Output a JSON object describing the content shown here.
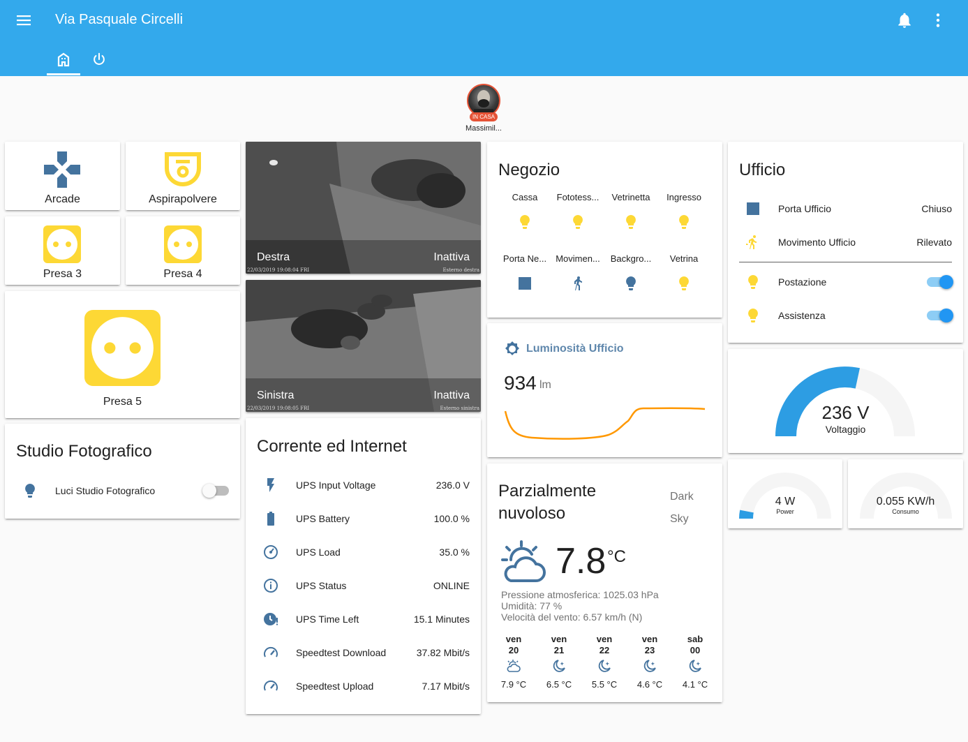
{
  "header": {
    "title": "Via Pasquale Circelli"
  },
  "icons": {
    "menu": "menu-icon",
    "bell": "bell-icon",
    "more": "dots-vertical-icon",
    "tab_home": "home-icon",
    "tab_power": "power-icon"
  },
  "colors": {
    "header": "#33a9ec",
    "on": "#fdd835",
    "off": "#44739e",
    "accent": "#2196f3",
    "graph": "#ff9800"
  },
  "person": {
    "name": "Massimil...",
    "badge": "IN CASA"
  },
  "buttons": {
    "arcade": "Arcade",
    "aspirapolvere": "Aspirapolvere",
    "presa3": "Presa 3",
    "presa4": "Presa 4",
    "presa5": "Presa 5"
  },
  "studio": {
    "title": "Studio Fotografico",
    "light": "Luci Studio Fotografico",
    "state": "off"
  },
  "cameras": [
    {
      "name": "Destra",
      "state": "Inattiva",
      "timestamp": "22/03/2019 19:08:04 FRI",
      "source": "Esterno destra"
    },
    {
      "name": "Sinistra",
      "state": "Inattiva",
      "timestamp": "22/03/2019 19:08:05 FRI",
      "source": "Esterno sinistra"
    }
  ],
  "ups": {
    "title": "Corrente ed Internet",
    "rows": [
      {
        "name": "UPS Input Voltage",
        "value": "236.0 V"
      },
      {
        "name": "UPS Battery",
        "value": "100.0 %"
      },
      {
        "name": "UPS Load",
        "value": "35.0 %"
      },
      {
        "name": "UPS Status",
        "value": "ONLINE"
      },
      {
        "name": "UPS Time Left",
        "value": "15.1 Minutes"
      },
      {
        "name": "Speedtest Download",
        "value": "37.82 Mbit/s"
      },
      {
        "name": "Speedtest Upload",
        "value": "7.17 Mbit/s"
      }
    ]
  },
  "negozio": {
    "title": "Negozio",
    "entities": [
      {
        "name": "Cassa"
      },
      {
        "name": "Fototess..."
      },
      {
        "name": "Vetrinetta"
      },
      {
        "name": "Ingresso"
      },
      {
        "name": "Porta Ne..."
      },
      {
        "name": "Movimen..."
      },
      {
        "name": "Backgro..."
      },
      {
        "name": "Vetrina"
      }
    ]
  },
  "luminosita": {
    "title": "Luminosità Ufficio",
    "value": "934",
    "unit": "lm"
  },
  "weather": {
    "condition_line1": "Parzialmente",
    "condition_line2": "nuvoloso",
    "provider_line1": "Dark",
    "provider_line2": "Sky",
    "temp": "7.8",
    "unit": "°C",
    "pressure": "Pressione atmosferica: 1025.03 hPa",
    "humidity": "Umidità: 77 %",
    "wind": "Velocità del vento: 6.57 km/h (N)",
    "forecast": [
      {
        "day": "ven",
        "num": "20",
        "temp": "7.9 °C"
      },
      {
        "day": "ven",
        "num": "21",
        "temp": "6.5 °C"
      },
      {
        "day": "ven",
        "num": "22",
        "temp": "5.5 °C"
      },
      {
        "day": "ven",
        "num": "23",
        "temp": "4.6 °C"
      },
      {
        "day": "sab",
        "num": "00",
        "temp": "4.1 °C"
      }
    ]
  },
  "ufficio": {
    "title": "Ufficio",
    "rows": [
      {
        "name": "Porta Ufficio",
        "value": "Chiuso"
      },
      {
        "name": "Movimento Ufficio",
        "value": "Rilevato"
      },
      {
        "name": "Postazione",
        "state": "on"
      },
      {
        "name": "Assistenza",
        "state": "on"
      }
    ]
  },
  "gauges": {
    "voltage": {
      "value": "236 V",
      "label": "Voltaggio",
      "fraction": 0.57
    },
    "power": {
      "value": "4 W",
      "label": "Power",
      "fraction": 0.06
    },
    "consumo": {
      "value": "0.055 KW/h",
      "label": "Consumo",
      "fraction": 0.0
    }
  }
}
